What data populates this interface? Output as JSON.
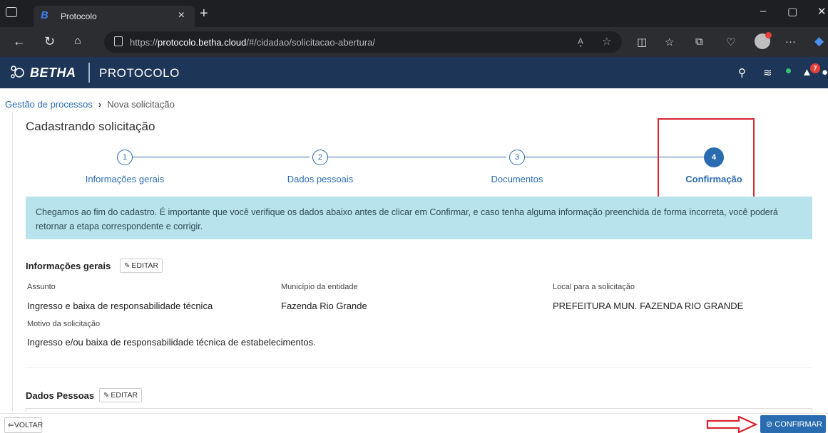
{
  "browser": {
    "tab_title": "Protocolo",
    "tab_close": "×",
    "new_tab": "+",
    "url_prefix": "https://",
    "url_host": "protocolo.betha.cloud",
    "url_path": "/#/cidadao/solicitacao-abertura/",
    "read_aloud": "A͓",
    "window_controls": [
      "–",
      "▢",
      "✕"
    ],
    "more": "···"
  },
  "app": {
    "brand": "BETHA",
    "name": "PROTOCOLO",
    "notification_count": "7"
  },
  "breadcrumb": {
    "parent": "Gestão de processos",
    "separator": "›",
    "current": "Nova solicitação"
  },
  "page": {
    "title": "Cadastrando solicitação"
  },
  "stepper": {
    "steps": [
      {
        "number": "1",
        "label": "Informações gerais"
      },
      {
        "number": "2",
        "label": "Dados pessoais"
      },
      {
        "number": "3",
        "label": "Documentos"
      },
      {
        "number": "4",
        "label": "Confirmação"
      }
    ],
    "active_step": 4
  },
  "alert": {
    "text": "Chegamos ao fim do cadastro. É importante que você verifique os dados abaixo antes de clicar em Confirmar, e caso tenha alguma informação preenchida de forma incorreta, você poderá retornar a etapa correspondente e corrigir."
  },
  "info_gerais": {
    "title": "Informações gerais",
    "edit_label": "EDITAR",
    "fields": [
      {
        "label": "Assunto",
        "value": "Ingresso e baixa de responsabilidade técnica"
      },
      {
        "label": "Município da entidade",
        "value": "Fazenda Rio Grande"
      },
      {
        "label": "Local para a solicitação",
        "value": "PREFEITURA MUN. FAZENDA RIO GRANDE"
      },
      {
        "label": "Motivo da solicitação",
        "value": "Ingresso e/ou baixa de responsabilidade técnica de estabelecimentos."
      }
    ]
  },
  "dados_pessoas": {
    "title": "Dados Pessoas",
    "edit_label": "EDITAR"
  },
  "footer": {
    "voltar_label": "VOLTAR",
    "confirmar_label": "CONFIRMAR"
  },
  "colors": {
    "header_bg": "#1d3557",
    "primary": "#2a6cb0",
    "alert_bg": "#b9e3ec",
    "highlight_red": "#d9242f"
  }
}
